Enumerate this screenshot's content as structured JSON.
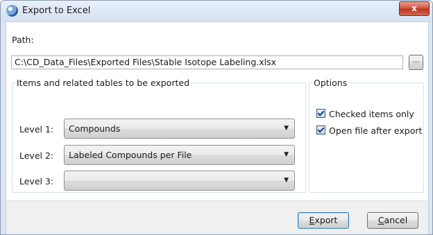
{
  "window": {
    "title": "Export to Excel",
    "close_label": "x"
  },
  "path": {
    "label": "Path:",
    "value": "C:\\CD_Data_Files\\Exported Files\\Stable Isotope Labeling.xlsx",
    "browse_label": "..."
  },
  "items_group": {
    "legend": "Items and related tables to be exported",
    "levels": [
      {
        "label": "Level 1:",
        "value": "Compounds"
      },
      {
        "label": "Level 2:",
        "value": "Labeled Compounds per File"
      },
      {
        "label": "Level 3:",
        "value": ""
      }
    ]
  },
  "options_group": {
    "legend": "Options",
    "options": [
      {
        "label": "Checked items only",
        "checked": true
      },
      {
        "label": "Open file after export",
        "checked": true
      }
    ]
  },
  "buttons": {
    "export_mnemonic": "E",
    "export_rest": "xport",
    "cancel_mnemonic": "C",
    "cancel_rest": "ancel"
  }
}
